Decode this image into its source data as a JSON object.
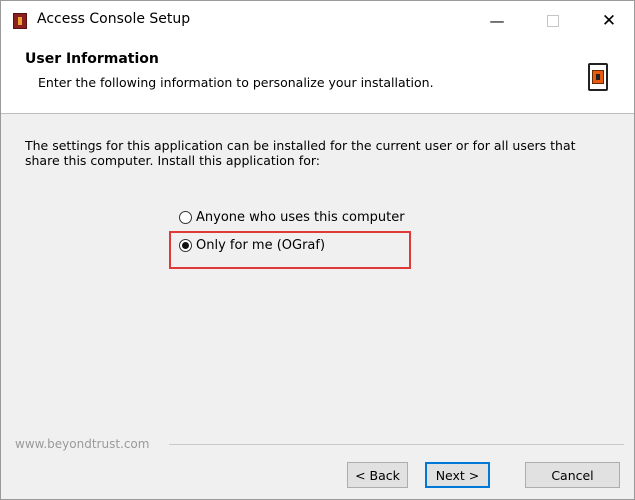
{
  "window": {
    "title": "Access Console Setup",
    "minimize": "—",
    "close": "✕"
  },
  "header": {
    "title": "User Information",
    "subtitle": "Enter the following information to personalize your installation."
  },
  "main": {
    "description": "The settings for this application can be installed for the current user or for all users that share this computer. Install this application for:",
    "options": [
      {
        "label": "Anyone who uses this computer",
        "selected": false
      },
      {
        "label": "Only for me (OGraf)",
        "selected": true
      }
    ]
  },
  "footer": {
    "brand": "www.beyondtrust.com",
    "back_label": "< Back",
    "next_label": "Next >",
    "cancel_label": "Cancel"
  },
  "colors": {
    "highlight": "#e0393a",
    "default_button_border": "#0078d7"
  }
}
